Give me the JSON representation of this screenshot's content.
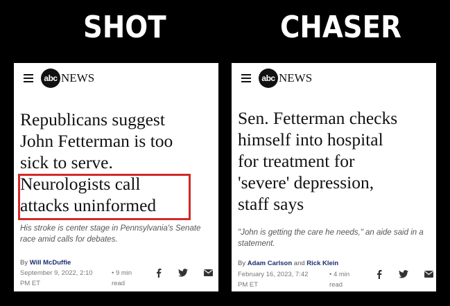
{
  "headings": {
    "left": "SHOT",
    "right": "CHASER"
  },
  "brand": {
    "disc": "abc",
    "word": "NEWS"
  },
  "left_article": {
    "title_lines": [
      "Republicans suggest",
      "John Fetterman is too",
      "sick to serve.",
      "Neurologists call",
      "attacks uninformed"
    ],
    "subhead": "His stroke is center stage in Pennsylvania's Senate race amid calls for debates.",
    "by": "By",
    "author": "Will McDuffie",
    "date_line1": "September 9, 2022, 2:10",
    "date_line2": "PM ET",
    "read_line1": "• 9 min",
    "read_line2": "read",
    "highlight_color": "#d32828"
  },
  "right_article": {
    "title_lines": [
      "Sen. Fetterman checks",
      "himself into hospital",
      "for treatment for",
      "'severe' depression,",
      "staff says"
    ],
    "subhead": "\"John is getting the care he needs,\" an aide said in a statement.",
    "by": "By",
    "author1": "Adam Carlson",
    "and": "and",
    "author2": "Rick Klein",
    "date_line1": "February 16, 2023, 7:42",
    "date_line2": "PM ET",
    "read_line1": "• 4 min",
    "read_line2": "read"
  },
  "icons": [
    "menu-icon",
    "facebook-icon",
    "twitter-icon",
    "email-icon"
  ]
}
